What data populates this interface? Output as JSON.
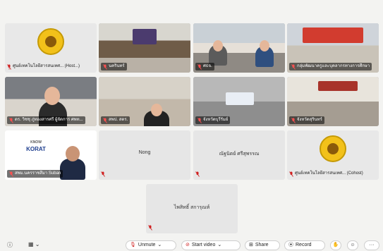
{
  "tiles": [
    {
      "name": "ศูนย์เทคโนโลยีสารสนเทศ... (Host...)",
      "type": "logo"
    },
    {
      "name": "นครินทร์",
      "type": "video"
    },
    {
      "name": "ศธจ.",
      "type": "video"
    },
    {
      "name": "กลุ่มพัฒนาครูและบุคลากรทางการศึกษา",
      "type": "video"
    },
    {
      "name": "ดร. วิชชุ ภู่ทองสารศรี ผู้จัดการ ศพท...",
      "type": "video"
    },
    {
      "name": "สพป. สตร.",
      "type": "video"
    },
    {
      "name": "จังหวัดบุรีรัมย์",
      "type": "video"
    },
    {
      "name": "จังหวัดสุรินทร์",
      "type": "video"
    },
    {
      "name": "สพม.นครราชสีมา Suban",
      "type": "video"
    },
    {
      "name": "Nong",
      "type": "blank"
    },
    {
      "name": "ณัฐนิตย์ ศรีสุพรรณ",
      "type": "blank"
    },
    {
      "name": "ศูนย์เทคโนโลยีสารสนเทศ... (Cohost)",
      "type": "logo"
    },
    {
      "name": "ไพสิทธิ์ สการุณห์",
      "type": "blank"
    }
  ],
  "korat_logo": {
    "line1": "KORAT",
    "line2": "KNOW"
  },
  "toolbar": {
    "unmute": "Unmute",
    "start_video": "Start video",
    "share": "Share",
    "record": "Record",
    "more": "···"
  },
  "colors": {
    "muted_icon": "#d02020",
    "logo_yellow": "#f2c11a"
  }
}
